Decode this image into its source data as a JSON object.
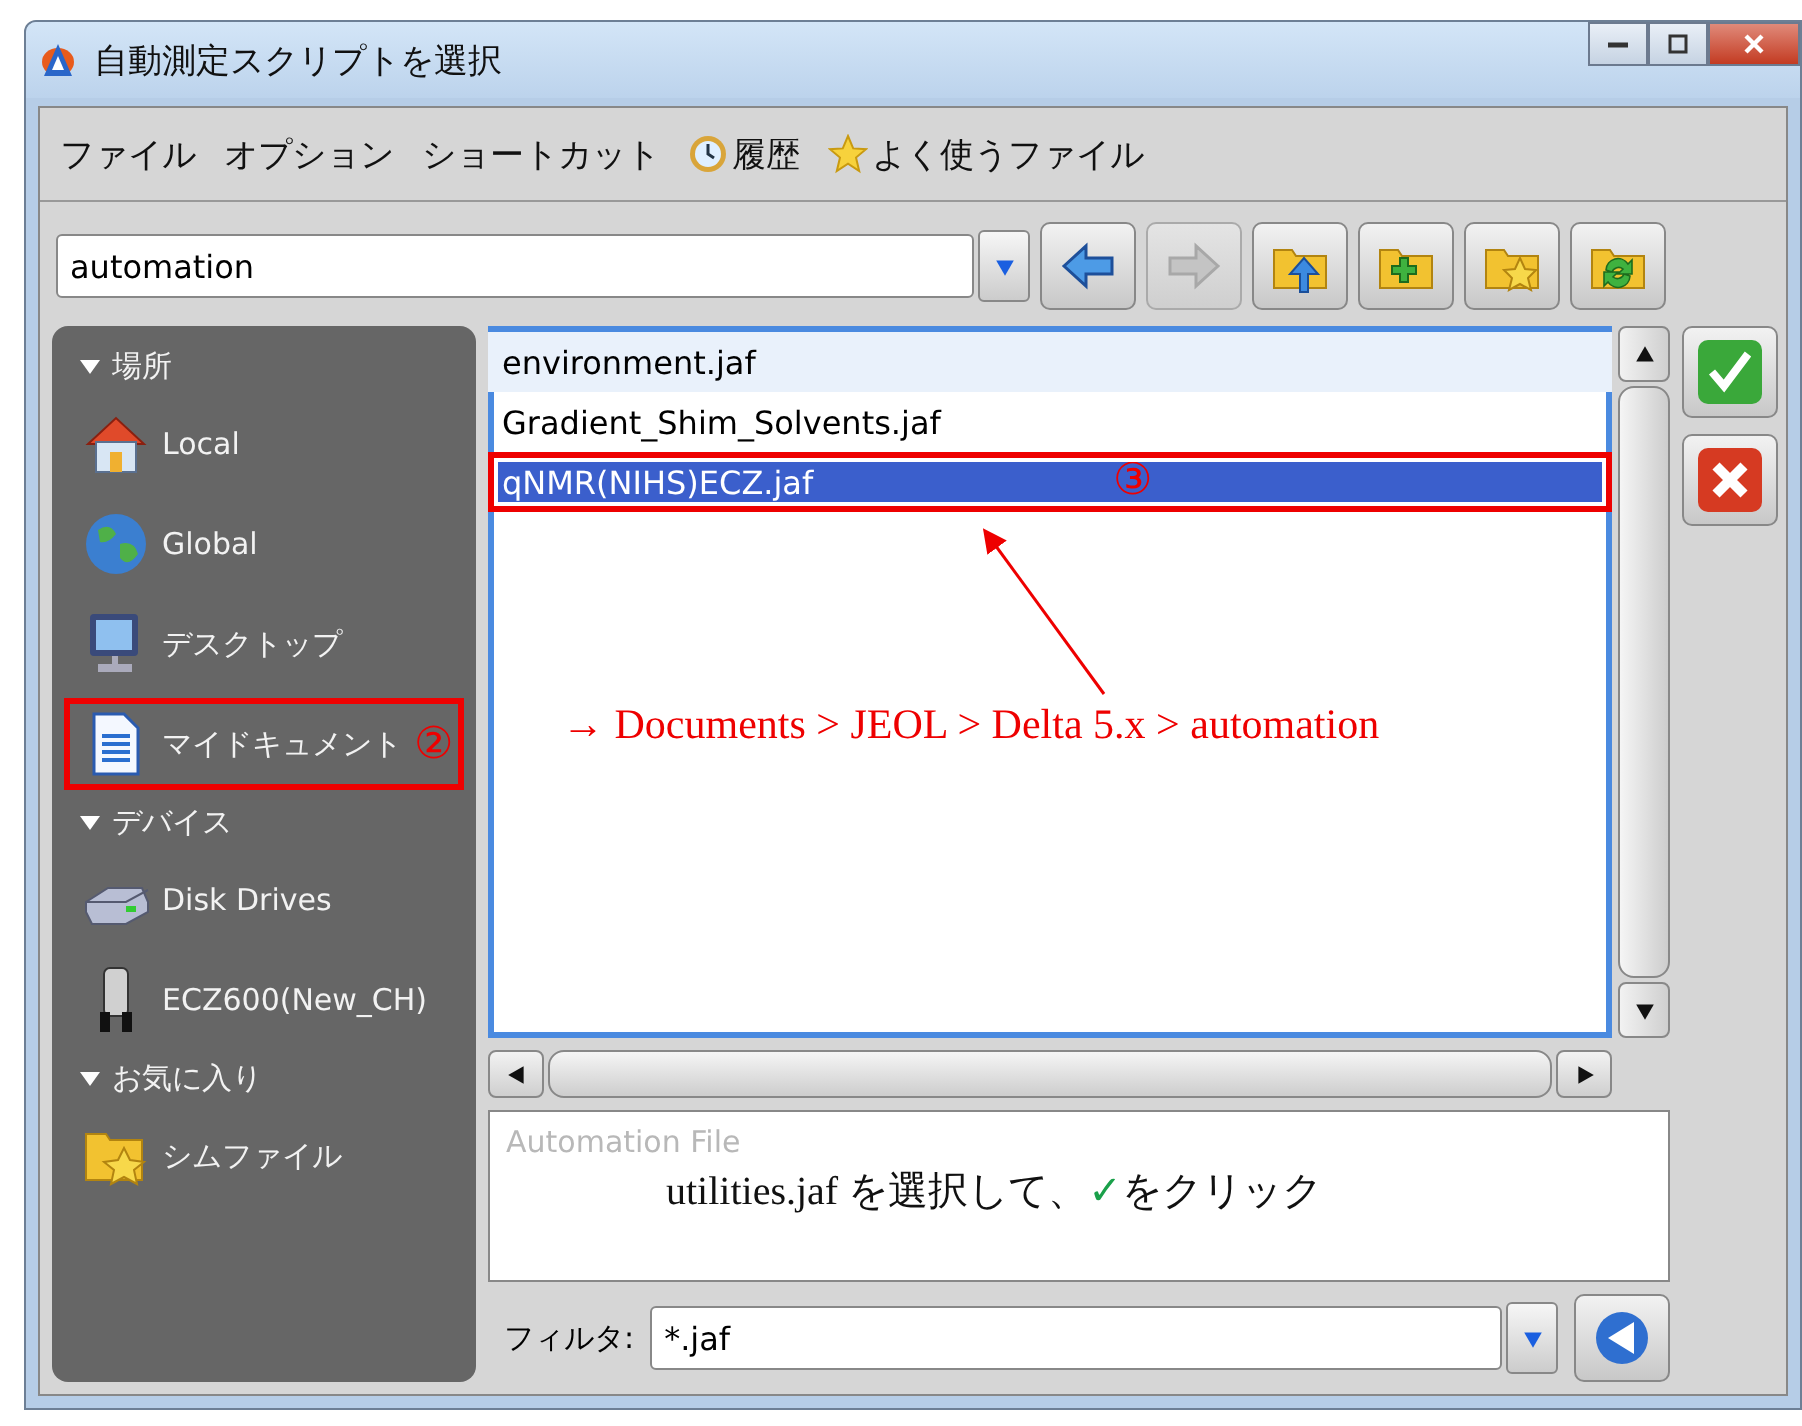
{
  "window": {
    "title": "自動測定スクリプトを選択"
  },
  "menu": [
    {
      "label": "ファイル"
    },
    {
      "label": "オプション"
    },
    {
      "label": "ショートカット"
    },
    {
      "label": "履歴"
    },
    {
      "label": "よく使うファイル"
    }
  ],
  "location": {
    "value": "automation"
  },
  "toolbar": [
    {
      "kind": "back",
      "disabled": false
    },
    {
      "kind": "forward",
      "disabled": true
    },
    {
      "kind": "folder-up",
      "disabled": false
    },
    {
      "kind": "folder-new",
      "disabled": false
    },
    {
      "kind": "folder-star",
      "disabled": false
    },
    {
      "kind": "folder-refresh",
      "disabled": false
    }
  ],
  "sidebar": [
    {
      "label": "場所",
      "expanded": true,
      "items": [
        {
          "label": "Local"
        },
        {
          "label": "Global"
        },
        {
          "label": "デスクトップ"
        },
        {
          "label": "マイドキュメント",
          "marker": "②"
        }
      ]
    },
    {
      "label": "デバイス",
      "expanded": true,
      "items": [
        {
          "label": "Disk Drives"
        },
        {
          "label": "ECZ600(New_CH)"
        }
      ]
    },
    {
      "label": "お気に入り",
      "expanded": true,
      "items": [
        {
          "label": "シムファイル"
        }
      ]
    }
  ],
  "files": [
    {
      "name": "environment.jaf",
      "selected": false
    },
    {
      "name": "Gradient_Shim_Solvents.jaf",
      "selected": false
    },
    {
      "name": "qNMR(NIHS)ECZ.jaf",
      "selected": true,
      "marker": "③"
    }
  ],
  "description": {
    "placeholder": "Automation File"
  },
  "filter": {
    "label": "フィルタ:",
    "value": "*.jaf"
  },
  "annotations": {
    "path_note": "→ Documents > JEOL > Delta 5.x > automation",
    "instruction": {
      "before": "utilities.jaf を選択して、",
      "check": "✓",
      "after": "をクリック"
    }
  }
}
